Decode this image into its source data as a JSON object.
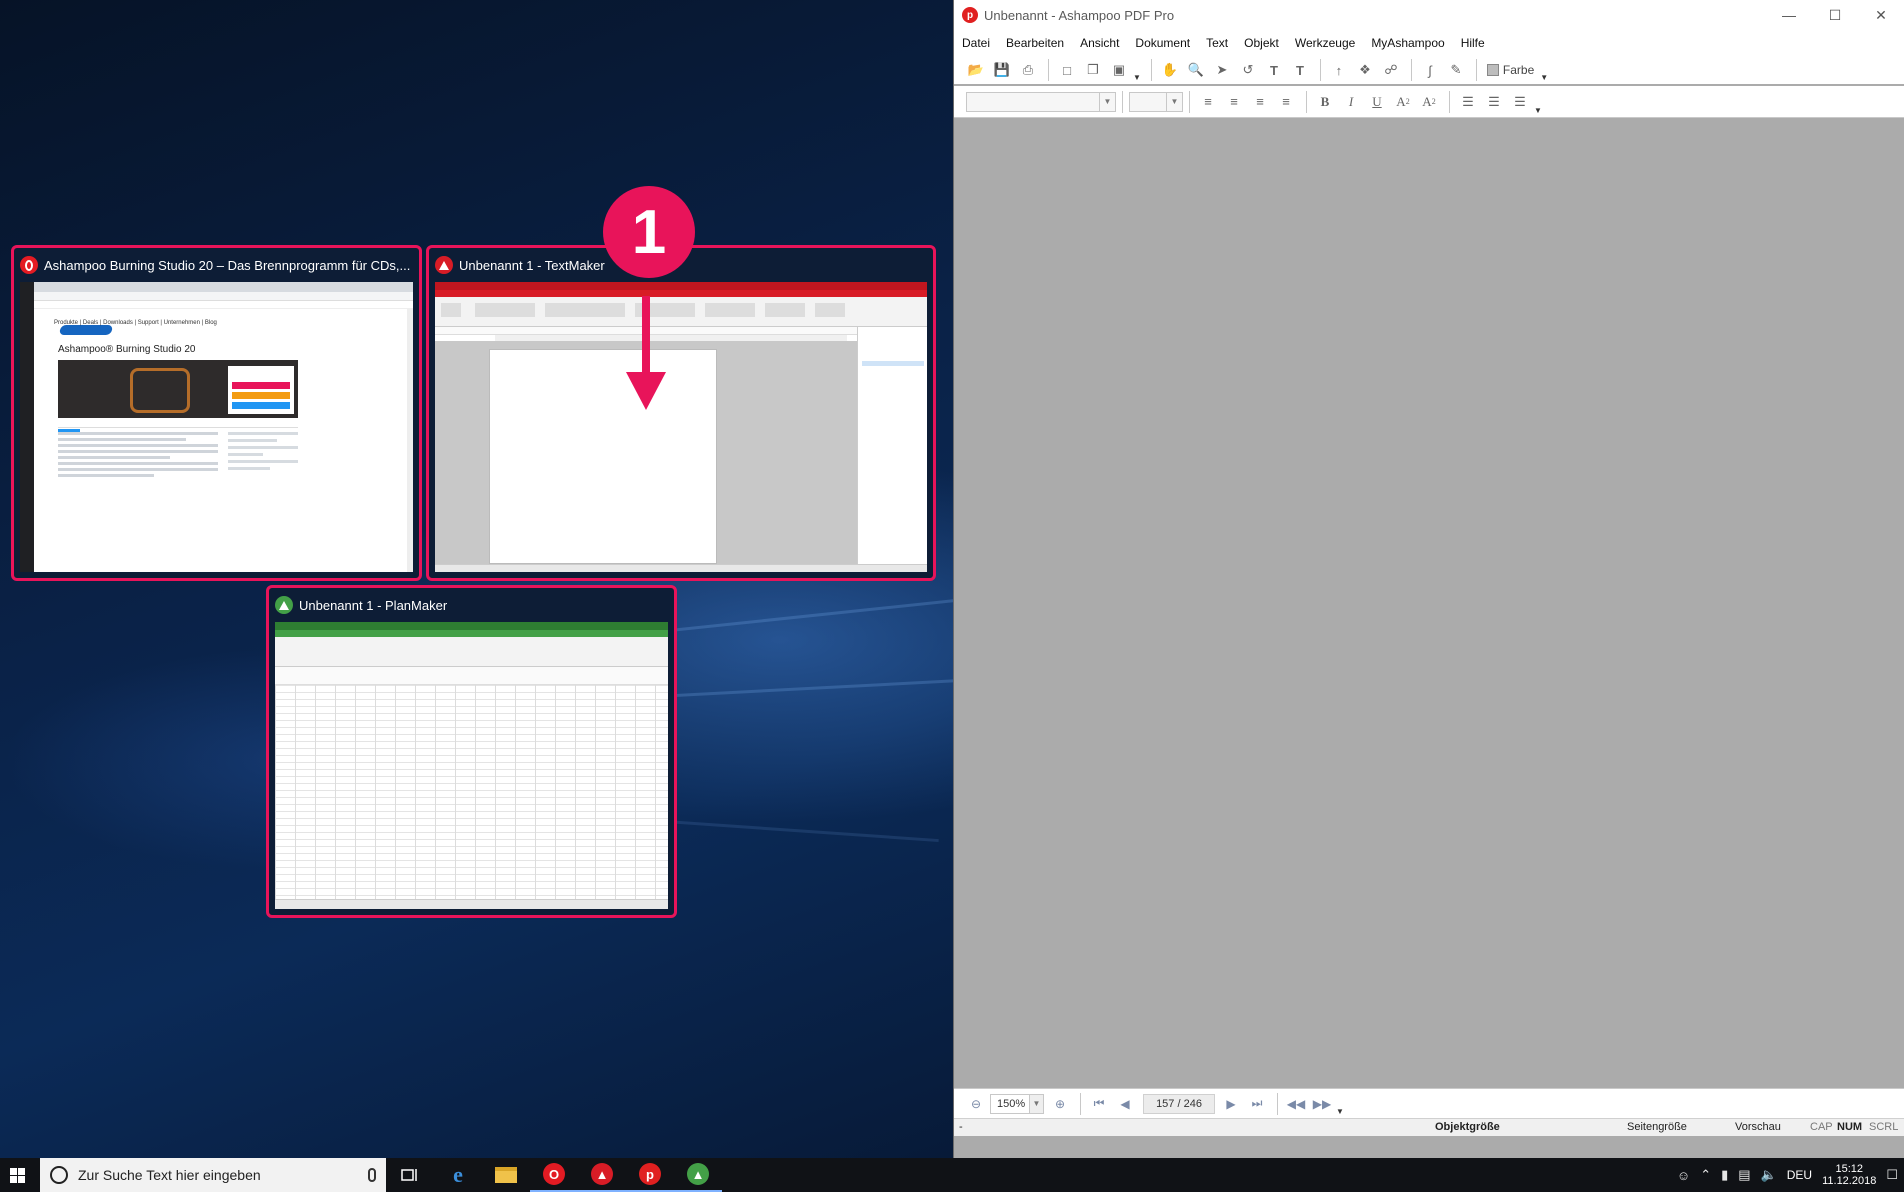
{
  "desktop": {
    "thumbnails": [
      {
        "title": "Ashampoo Burning Studio 20 – Das Brennprogramm für CDs,...",
        "icon": "opera-icon",
        "preview_heading": "Ashampoo® Burning Studio 20"
      },
      {
        "title": "Unbenannt 1 - TextMaker",
        "icon": "textmaker-icon"
      },
      {
        "title": "Unbenannt 1 - PlanMaker",
        "icon": "planmaker-icon"
      }
    ],
    "badge": "1"
  },
  "pdf_window": {
    "title": "Unbenannt - Ashampoo PDF Pro",
    "menu": [
      "Datei",
      "Bearbeiten",
      "Ansicht",
      "Dokument",
      "Text",
      "Objekt",
      "Werkzeuge",
      "MyAshampoo",
      "Hilfe"
    ],
    "toolbar1": {
      "color_label": "Farbe"
    },
    "navbar": {
      "zoom": "150%",
      "page": "157 / 246"
    },
    "statusbar": {
      "left": "-",
      "object_size": "Objektgröße",
      "page_size": "Seitengröße",
      "preview": "Vorschau",
      "cap": "CAP",
      "num": "NUM",
      "scrl": "SCRL"
    }
  },
  "taskbar": {
    "search_placeholder": "Zur Suche Text hier eingeben",
    "language": "DEU",
    "time": "15:12",
    "date": "11.12.2018"
  },
  "colors": {
    "highlight": "#e8145a",
    "textmaker_red": "#d81c26",
    "planmaker_green": "#43a047",
    "pdf_red": "#e02020"
  }
}
